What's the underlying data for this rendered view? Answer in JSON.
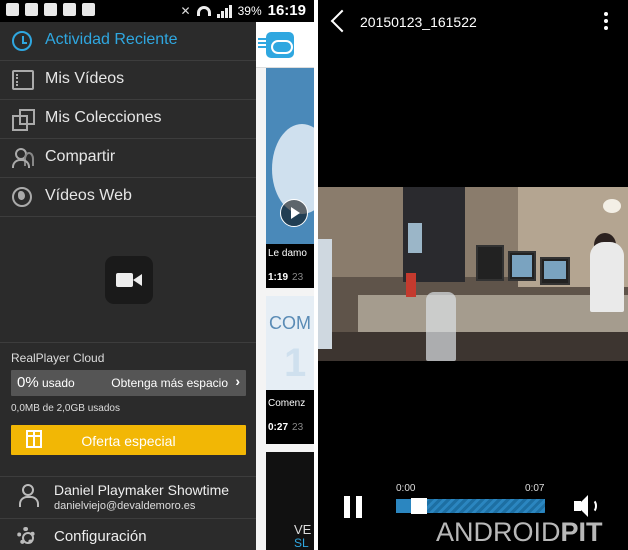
{
  "status_bar": {
    "battery": "39%",
    "time": "16:19"
  },
  "drawer": {
    "items": [
      {
        "label": "Actividad Reciente",
        "icon": "clock-icon",
        "active": true
      },
      {
        "label": "Mis Vídeos",
        "icon": "film-icon",
        "active": false
      },
      {
        "label": "Mis Colecciones",
        "icon": "collections-icon",
        "active": false
      },
      {
        "label": "Compartir",
        "icon": "share-people-icon",
        "active": false
      },
      {
        "label": "Vídeos Web",
        "icon": "globe-icon",
        "active": false
      }
    ],
    "cloud": {
      "title": "RealPlayer Cloud",
      "usage_percent": "0%",
      "usage_word": "usado",
      "more_space": "Obtenga más espacio",
      "usage_detail": "0,0MB de 2,0GB usados"
    },
    "offer_label": "Oferta especial",
    "user": {
      "name": "Daniel Playmaker Showtime",
      "email": "danielviejo@devaldemoro.es"
    },
    "config_label": "Configuración"
  },
  "peek": {
    "card1": {
      "title": "Le damo",
      "duration": "1:19",
      "date": "23"
    },
    "card2": {
      "heading": "COM",
      "big": "1",
      "title": "Comenz",
      "duration": "0:27",
      "date": "23"
    },
    "card3": {
      "line1": "VE",
      "line2": "SL"
    }
  },
  "player": {
    "title": "20150123_161522",
    "time_current": "0:00",
    "time_total": "0:07",
    "progress": 0.1
  },
  "watermark": {
    "part1": "ANDROID",
    "part2": "PIT"
  },
  "colors": {
    "accent": "#2fa7e0",
    "offer": "#f2b705",
    "seek": "#2b86c0"
  }
}
